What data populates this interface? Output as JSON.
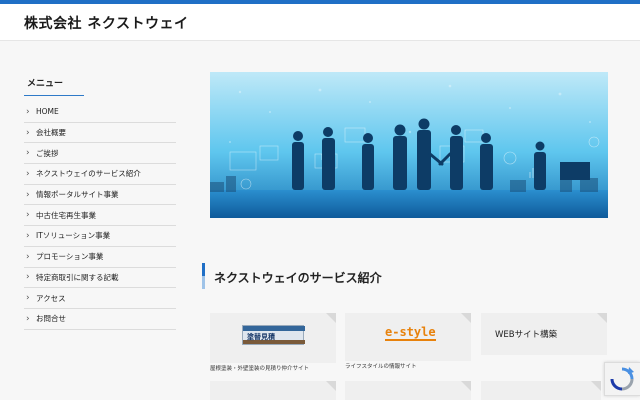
{
  "header": {
    "site_title": "株式会社 ネクストウェイ"
  },
  "sidebar": {
    "heading": "メニュー",
    "items": [
      {
        "label": "HOME"
      },
      {
        "label": "会社概要"
      },
      {
        "label": "ご挨拶"
      },
      {
        "label": "ネクストウェイのサービス紹介"
      },
      {
        "label": "情報ポータルサイト事業"
      },
      {
        "label": "中古住宅再生事業"
      },
      {
        "label": "ITソリューション事業"
      },
      {
        "label": "プロモーション事業"
      },
      {
        "label": "特定商取引に関する記載"
      },
      {
        "label": "アクセス"
      },
      {
        "label": "お問合せ"
      }
    ]
  },
  "main": {
    "section_title": "ネクストウェイのサービス紹介",
    "cards": [
      {
        "logo_text": "塗替見積",
        "caption": "屋根塗装・外壁塗装の見積り仲介サイト"
      },
      {
        "logo_text": "e-style",
        "caption": "ライフスタイルの情報サイト"
      },
      {
        "label": "WEBサイト構築"
      }
    ]
  },
  "colors": {
    "accent": "#1f6fc6",
    "estyle_orange": "#e8820c"
  }
}
